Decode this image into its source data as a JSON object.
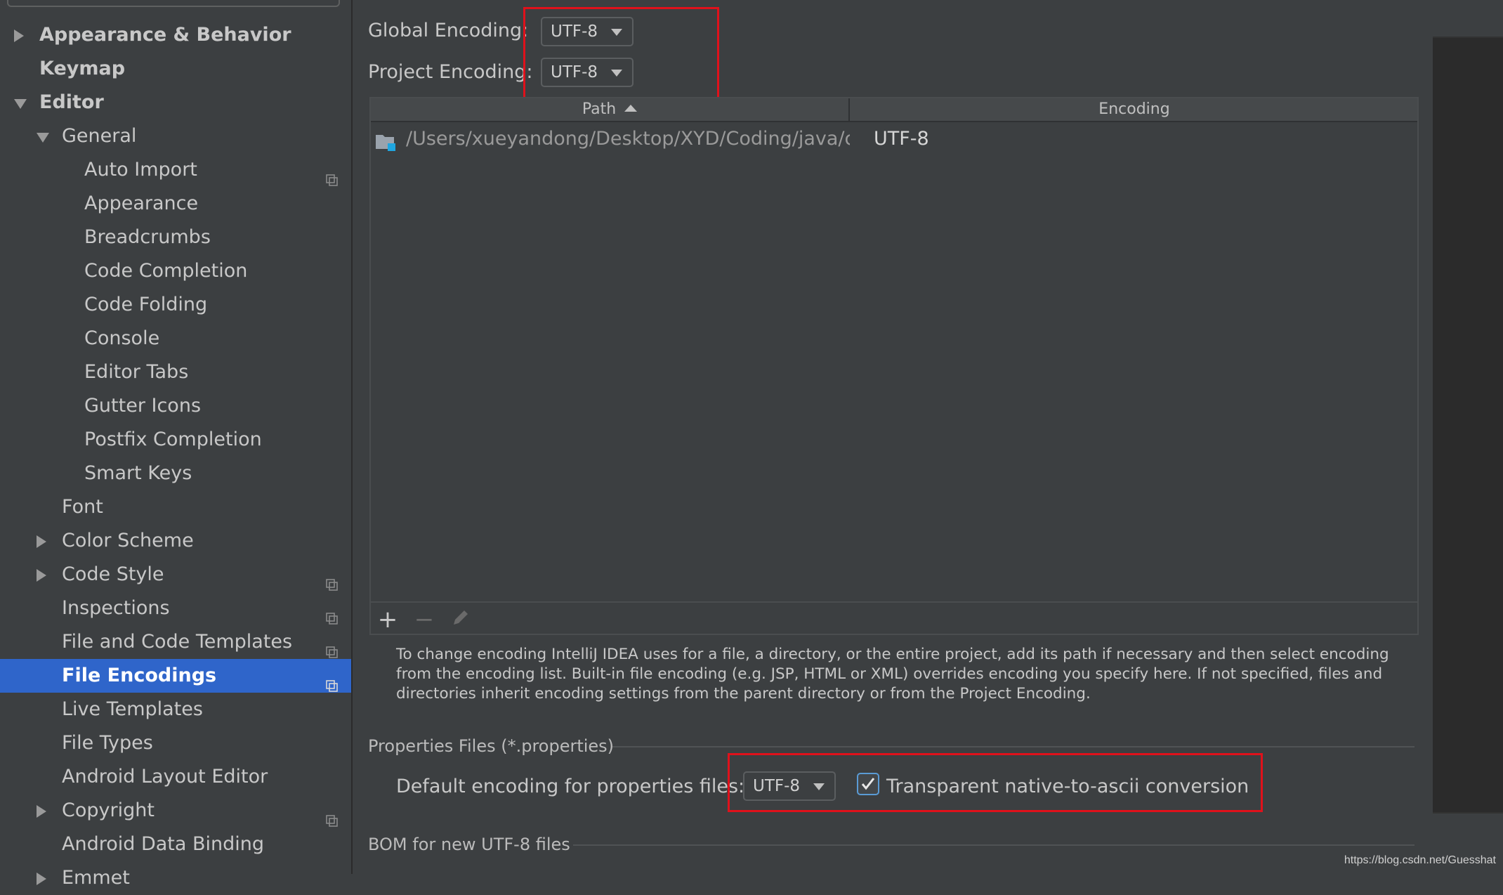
{
  "sidebar": {
    "items": [
      {
        "label": "Appearance & Behavior",
        "level": 0,
        "arrow": "right",
        "bold": true,
        "copy_icon": false,
        "selected": false
      },
      {
        "label": "Keymap",
        "level": 0,
        "arrow": "none",
        "bold": true,
        "copy_icon": false,
        "selected": false
      },
      {
        "label": "Editor",
        "level": 0,
        "arrow": "down",
        "bold": true,
        "copy_icon": false,
        "selected": false
      },
      {
        "label": "General",
        "level": 1,
        "arrow": "down",
        "bold": false,
        "copy_icon": false,
        "selected": false
      },
      {
        "label": "Auto Import",
        "level": 2,
        "arrow": "none",
        "bold": false,
        "copy_icon": true,
        "selected": false
      },
      {
        "label": "Appearance",
        "level": 2,
        "arrow": "none",
        "bold": false,
        "copy_icon": false,
        "selected": false
      },
      {
        "label": "Breadcrumbs",
        "level": 2,
        "arrow": "none",
        "bold": false,
        "copy_icon": false,
        "selected": false
      },
      {
        "label": "Code Completion",
        "level": 2,
        "arrow": "none",
        "bold": false,
        "copy_icon": false,
        "selected": false
      },
      {
        "label": "Code Folding",
        "level": 2,
        "arrow": "none",
        "bold": false,
        "copy_icon": false,
        "selected": false
      },
      {
        "label": "Console",
        "level": 2,
        "arrow": "none",
        "bold": false,
        "copy_icon": false,
        "selected": false
      },
      {
        "label": "Editor Tabs",
        "level": 2,
        "arrow": "none",
        "bold": false,
        "copy_icon": false,
        "selected": false
      },
      {
        "label": "Gutter Icons",
        "level": 2,
        "arrow": "none",
        "bold": false,
        "copy_icon": false,
        "selected": false
      },
      {
        "label": "Postfix Completion",
        "level": 2,
        "arrow": "none",
        "bold": false,
        "copy_icon": false,
        "selected": false
      },
      {
        "label": "Smart Keys",
        "level": 2,
        "arrow": "none",
        "bold": false,
        "copy_icon": false,
        "selected": false
      },
      {
        "label": "Font",
        "level": 1,
        "arrow": "none",
        "bold": false,
        "copy_icon": false,
        "selected": false
      },
      {
        "label": "Color Scheme",
        "level": 1,
        "arrow": "right",
        "bold": false,
        "copy_icon": false,
        "selected": false
      },
      {
        "label": "Code Style",
        "level": 1,
        "arrow": "right",
        "bold": false,
        "copy_icon": true,
        "selected": false
      },
      {
        "label": "Inspections",
        "level": 1,
        "arrow": "none",
        "bold": false,
        "copy_icon": true,
        "selected": false
      },
      {
        "label": "File and Code Templates",
        "level": 1,
        "arrow": "none",
        "bold": false,
        "copy_icon": true,
        "selected": false
      },
      {
        "label": "File Encodings",
        "level": 1,
        "arrow": "none",
        "bold": true,
        "copy_icon": true,
        "selected": true
      },
      {
        "label": "Live Templates",
        "level": 1,
        "arrow": "none",
        "bold": false,
        "copy_icon": false,
        "selected": false
      },
      {
        "label": "File Types",
        "level": 1,
        "arrow": "none",
        "bold": false,
        "copy_icon": false,
        "selected": false
      },
      {
        "label": "Android Layout Editor",
        "level": 1,
        "arrow": "none",
        "bold": false,
        "copy_icon": false,
        "selected": false
      },
      {
        "label": "Copyright",
        "level": 1,
        "arrow": "right",
        "bold": false,
        "copy_icon": true,
        "selected": false
      },
      {
        "label": "Android Data Binding",
        "level": 1,
        "arrow": "none",
        "bold": false,
        "copy_icon": false,
        "selected": false
      },
      {
        "label": "Emmet",
        "level": 1,
        "arrow": "right",
        "bold": false,
        "copy_icon": false,
        "selected": false
      }
    ]
  },
  "main": {
    "global_encoding_label": "Global Encoding:",
    "global_encoding_value": "UTF-8",
    "project_encoding_label": "Project Encoding:",
    "project_encoding_value": "UTF-8",
    "table": {
      "col_path": "Path",
      "col_encoding": "Encoding",
      "rows": [
        {
          "path": "/Users/xueyandong/Desktop/XYD/Coding/java/c",
          "encoding": "UTF-8"
        }
      ]
    },
    "toolbar": {
      "add": "+",
      "remove": "−"
    },
    "help_text": "To change encoding IntelliJ IDEA uses for a file, a directory, or the entire project, add its path if necessary and then select encoding from the encoding list. Built-in file encoding (e.g. JSP, HTML or XML) overrides encoding you specify here. If not specified, files and directories inherit encoding settings from the parent directory or from the Project Encoding.",
    "properties_section_title": "Properties Files (*.properties)",
    "default_properties_label": "Default encoding for properties files:",
    "default_properties_value": "UTF-8",
    "transparent_label": "Transparent native-to-ascii conversion",
    "transparent_checked": true,
    "bom_section_title": "BOM for new UTF-8 files"
  },
  "watermark": "https://blog.csdn.net/Guesshat",
  "colors": {
    "selection": "#2f65ca",
    "highlight_box": "#e0111b",
    "folder_icon": "#9aa3ad",
    "folder_badge": "#1fa6e0"
  }
}
